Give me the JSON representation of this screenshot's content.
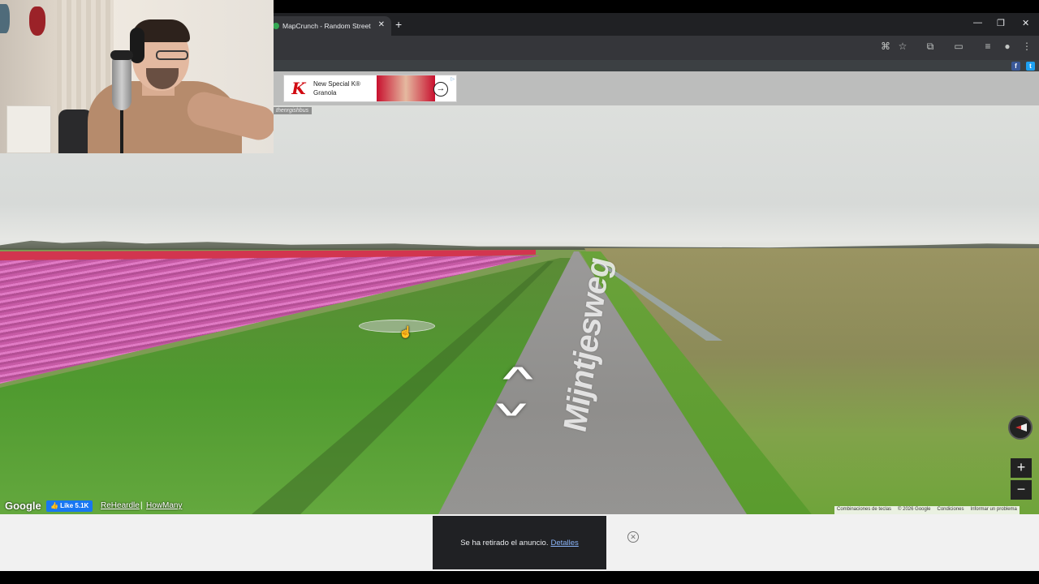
{
  "browser": {
    "tab_title": "MapCrunch - Random Street Vi",
    "tab_close": "✕",
    "new_tab": "+",
    "window_controls": {
      "minimize": "—",
      "restore": "❐",
      "close": "✕"
    },
    "toolbar_icons": [
      "translate-icon",
      "star-icon",
      "extensions-icon",
      "cast-icon",
      "media-icon",
      "profile-icon",
      "menu-icon"
    ]
  },
  "site": {
    "social": {
      "facebook": "f",
      "twitter": "t"
    },
    "ad_top": {
      "logo": "K",
      "text": "New Special K® Granola",
      "arrow": "→",
      "adchoice": "▷"
    },
    "overlay_label": "thenrgishbus"
  },
  "streetview": {
    "road_name": "Mijntjesweg",
    "google_logo": "Google",
    "fb_like": "👍 Like 5.1K",
    "links": [
      "ReHeardle",
      "HowMany"
    ],
    "separator": "|",
    "zoom_in": "+",
    "zoom_out": "−",
    "attribution": [
      "Combinaciones de teclas",
      "© 2026 Google",
      "Condiciones",
      "Informar un problema"
    ]
  },
  "bottom_ad": {
    "message": "Se ha retirado el anuncio.",
    "details_link": "Detalles",
    "close": "✕"
  }
}
